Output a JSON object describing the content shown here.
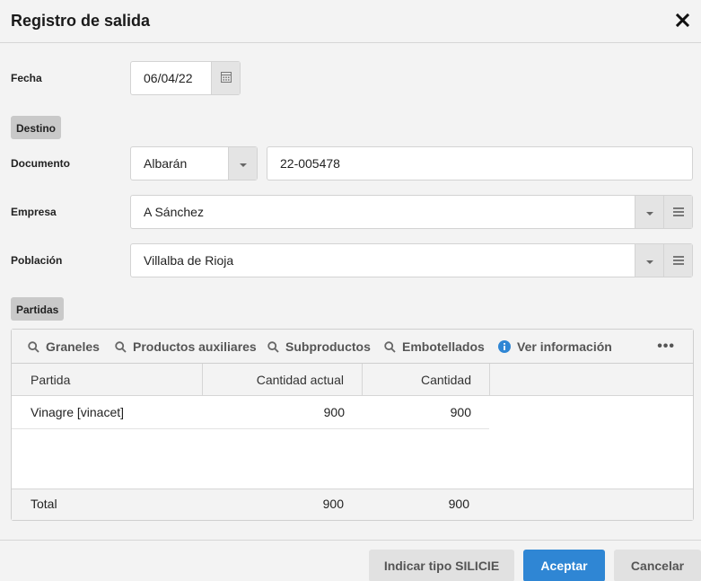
{
  "dialog": {
    "title": "Registro de salida"
  },
  "fecha": {
    "label": "Fecha",
    "value": "06/04/22"
  },
  "destino": {
    "section": "Destino",
    "documento": {
      "label": "Documento",
      "type_value": "Albarán",
      "number_value": "22-005478"
    },
    "empresa": {
      "label": "Empresa",
      "value": "A Sánchez"
    },
    "poblacion": {
      "label": "Población",
      "value": "Villalba de Rioja"
    }
  },
  "partidas": {
    "section": "Partidas",
    "toolbar": {
      "graneles": "Graneles",
      "productos_auxiliares": "Productos auxiliares",
      "subproductos": "Subproductos",
      "embotellados": "Embotellados",
      "ver_informacion": "Ver información",
      "more": "•••"
    },
    "columns": [
      "Partida",
      "Cantidad actual",
      "Cantidad"
    ],
    "rows": [
      {
        "partida": "Vinagre [vinacet]",
        "cantidad_actual": "900",
        "cantidad": "900"
      }
    ],
    "total": {
      "label": "Total",
      "cantidad_actual": "900",
      "cantidad": "900"
    }
  },
  "footer": {
    "indicar_tipo": "Indicar tipo SILICIE",
    "aceptar": "Aceptar",
    "cancelar": "Cancelar"
  },
  "colors": {
    "primary": "#2f86d4",
    "info_icon": "#2f86d4",
    "tag_bg": "#c9c9c9"
  }
}
